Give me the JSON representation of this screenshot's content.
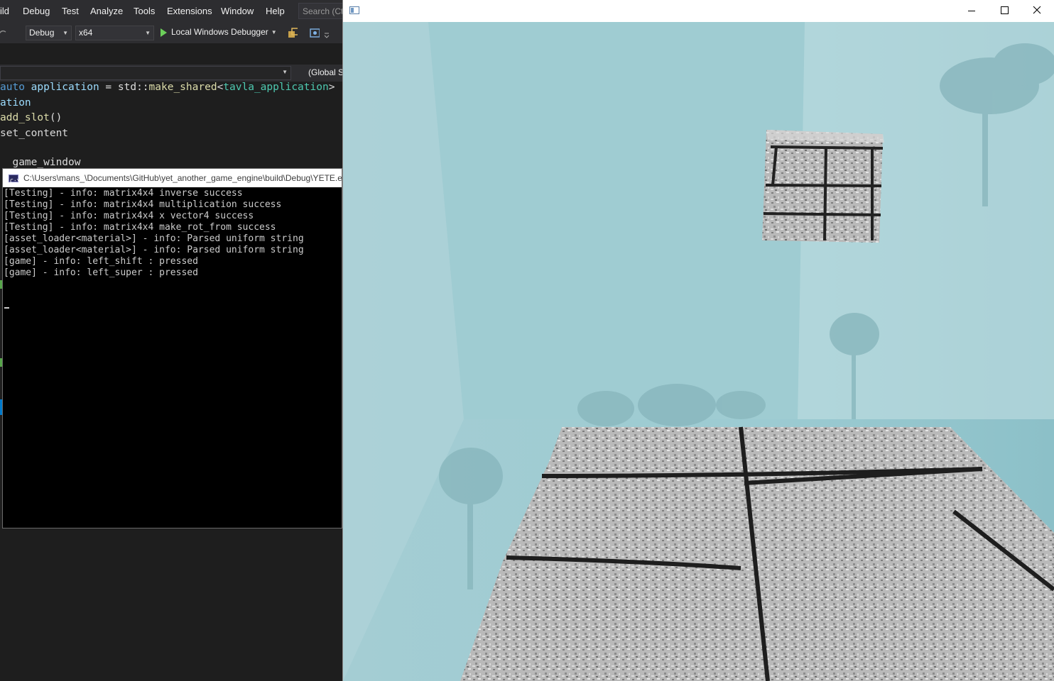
{
  "vs": {
    "menu": [
      "ild",
      "Debug",
      "Test",
      "Analyze",
      "Tools",
      "Extensions",
      "Window",
      "Help"
    ],
    "search_placeholder": "Search (Ct",
    "toolbar": {
      "config": "Debug",
      "platform": "x64",
      "run_label": "Local Windows Debugger"
    },
    "nav": {
      "scope": "(Global S"
    },
    "code": {
      "line1_kw": "auto",
      "line1_var": "application",
      "line1_eq": " = std::",
      "line1_fn": "make_shared",
      "line1_lt": "<",
      "line1_type": "tavla_application",
      "line1_gt": ">",
      "line2": "ation",
      "line3_fn": "add_slot",
      "line3_rest": "()",
      "line4": "set_content",
      "line5": "  game_window"
    }
  },
  "console": {
    "title": "C:\\Users\\mans_\\Documents\\GitHub\\yet_another_game_engine\\build\\Debug\\YETE.exe",
    "lines": [
      "[Testing] - info: matrix4x4 inverse success",
      "[Testing] - info: matrix4x4 multiplication success",
      "[Testing] - info: matrix4x4 x vector4 success",
      "[Testing] - info: matrix4x4 make_rot_from success",
      "[asset_loader<material>] - info: Parsed uniform string",
      "[asset_loader<material>] - info: Parsed uniform string",
      "[game] - info: left_shift : pressed",
      "[game] - info: left_super : pressed"
    ]
  },
  "game": {
    "title": "",
    "colors": {
      "sky": "#a9d0d6",
      "sky_dark": "#8fc1c8",
      "stone": "#b9b9b9",
      "mortar": "#222222"
    }
  }
}
